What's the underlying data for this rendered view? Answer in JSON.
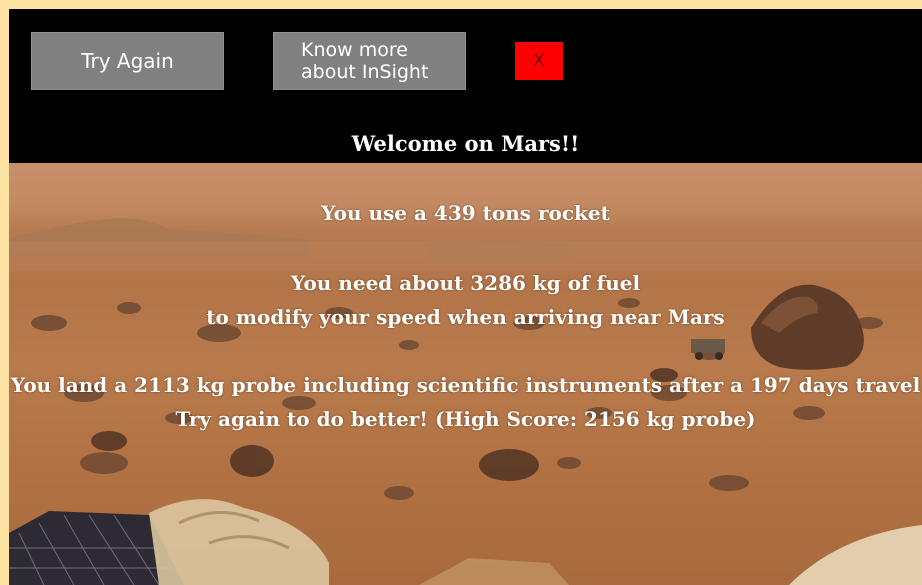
{
  "buttons": {
    "try_again": "Try Again",
    "know_more_line1": "Know more",
    "know_more_line2": "about InSight",
    "close": "X"
  },
  "welcome": "Welcome on Mars!!",
  "results": {
    "rocket": "You use a 439 tons rocket",
    "fuel_line1": "You need about 3286 kg of fuel",
    "fuel_line2": "to modify your speed when arriving near Mars",
    "probe": "You land a 2113 kg probe including scientific instruments after a 197 days travel",
    "try_again_msg": "Try again to do better! (High Score: 2156 kg probe)"
  },
  "colors": {
    "page_border": "#fde3a3",
    "button_gray": "#808080",
    "close_red": "#ff0000"
  }
}
